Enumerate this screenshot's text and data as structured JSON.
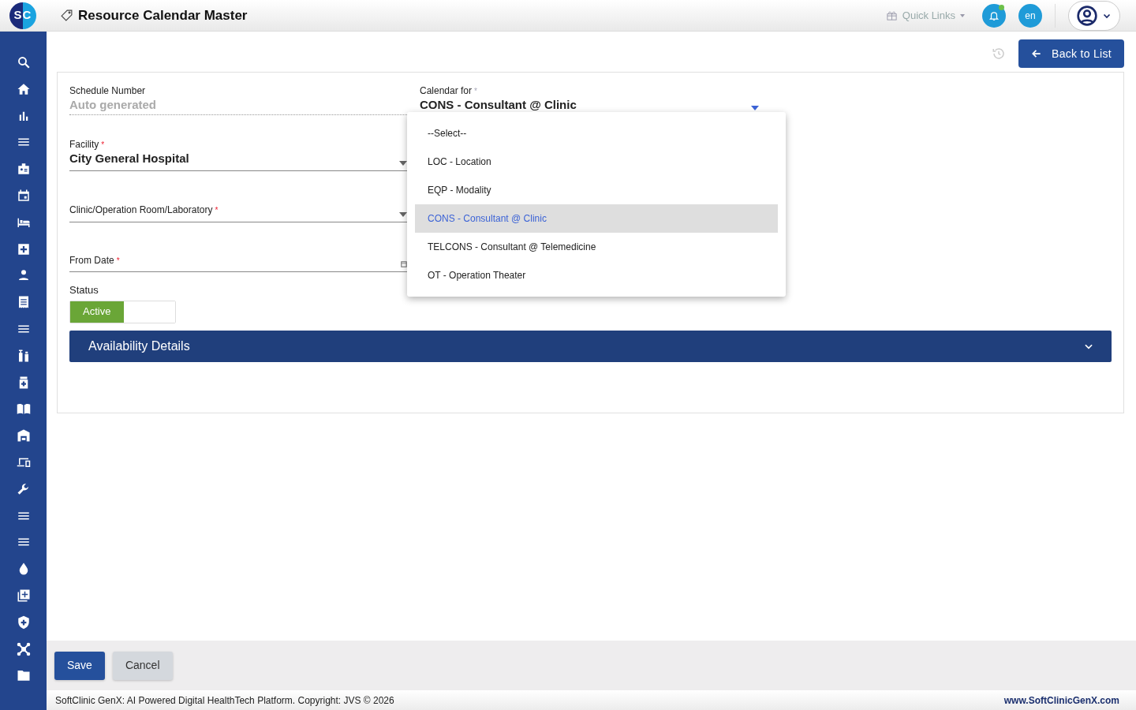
{
  "header": {
    "logo": "SC",
    "title": "Resource Calendar Master",
    "quick_links": "Quick Links",
    "language": "en"
  },
  "toolbar": {
    "back_button": "Back to List"
  },
  "form": {
    "schedule_number": {
      "label": "Schedule Number",
      "placeholder": "Auto generated"
    },
    "facility": {
      "label": "Facility",
      "required_mark": "*",
      "value": "City General Hospital"
    },
    "clinic": {
      "label": "Clinic/Operation Room/Laboratory",
      "required_mark": "*"
    },
    "from_date": {
      "label": "From Date",
      "required_mark": "*"
    },
    "calendar_for": {
      "label": "Calendar for",
      "required_mark": "*",
      "value": "CONS - Consultant @ Clinic",
      "expanded": true,
      "options": [
        {
          "label": "--Select--",
          "selected": false
        },
        {
          "label": "LOC - Location",
          "selected": false
        },
        {
          "label": "EQP - Modality",
          "selected": false
        },
        {
          "label": "CONS - Consultant @ Clinic",
          "selected": true
        },
        {
          "label": "TELCONS - Consultant @ Telemedicine",
          "selected": false
        },
        {
          "label": "OT - Operation Theater",
          "selected": false
        }
      ]
    },
    "status": {
      "label": "Status",
      "toggle": "Active",
      "on": true
    }
  },
  "section": {
    "title": "Availability Details",
    "expanded": false
  },
  "buttons": [
    {
      "label": "Save",
      "kind": "primary"
    },
    {
      "label": "Cancel",
      "kind": "secondary"
    }
  ],
  "footer": {
    "copyright": "SoftClinic GenX: AI Powered Digital HealthTech Platform. Copyright: JVS © 2026",
    "link": "www.SoftClinicGenX.com"
  }
}
